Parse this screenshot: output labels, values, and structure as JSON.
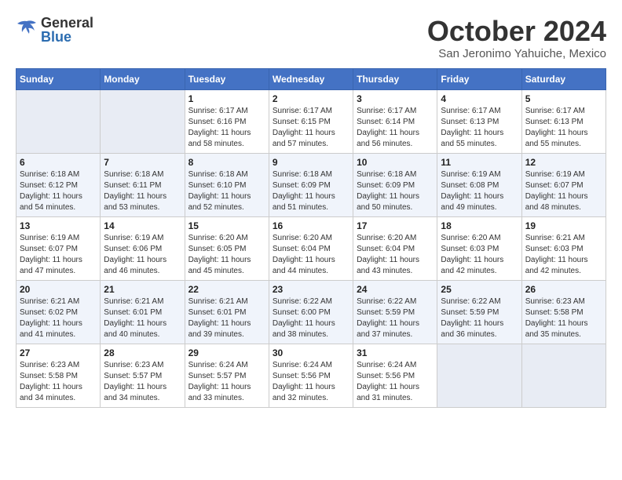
{
  "header": {
    "logo_general": "General",
    "logo_blue": "Blue",
    "month_title": "October 2024",
    "location": "San Jeronimo Yahuiche, Mexico"
  },
  "weekdays": [
    "Sunday",
    "Monday",
    "Tuesday",
    "Wednesday",
    "Thursday",
    "Friday",
    "Saturday"
  ],
  "weeks": [
    [
      {
        "day": "",
        "info": ""
      },
      {
        "day": "",
        "info": ""
      },
      {
        "day": "1",
        "info": "Sunrise: 6:17 AM\nSunset: 6:16 PM\nDaylight: 11 hours and 58 minutes."
      },
      {
        "day": "2",
        "info": "Sunrise: 6:17 AM\nSunset: 6:15 PM\nDaylight: 11 hours and 57 minutes."
      },
      {
        "day": "3",
        "info": "Sunrise: 6:17 AM\nSunset: 6:14 PM\nDaylight: 11 hours and 56 minutes."
      },
      {
        "day": "4",
        "info": "Sunrise: 6:17 AM\nSunset: 6:13 PM\nDaylight: 11 hours and 55 minutes."
      },
      {
        "day": "5",
        "info": "Sunrise: 6:17 AM\nSunset: 6:13 PM\nDaylight: 11 hours and 55 minutes."
      }
    ],
    [
      {
        "day": "6",
        "info": "Sunrise: 6:18 AM\nSunset: 6:12 PM\nDaylight: 11 hours and 54 minutes."
      },
      {
        "day": "7",
        "info": "Sunrise: 6:18 AM\nSunset: 6:11 PM\nDaylight: 11 hours and 53 minutes."
      },
      {
        "day": "8",
        "info": "Sunrise: 6:18 AM\nSunset: 6:10 PM\nDaylight: 11 hours and 52 minutes."
      },
      {
        "day": "9",
        "info": "Sunrise: 6:18 AM\nSunset: 6:09 PM\nDaylight: 11 hours and 51 minutes."
      },
      {
        "day": "10",
        "info": "Sunrise: 6:18 AM\nSunset: 6:09 PM\nDaylight: 11 hours and 50 minutes."
      },
      {
        "day": "11",
        "info": "Sunrise: 6:19 AM\nSunset: 6:08 PM\nDaylight: 11 hours and 49 minutes."
      },
      {
        "day": "12",
        "info": "Sunrise: 6:19 AM\nSunset: 6:07 PM\nDaylight: 11 hours and 48 minutes."
      }
    ],
    [
      {
        "day": "13",
        "info": "Sunrise: 6:19 AM\nSunset: 6:07 PM\nDaylight: 11 hours and 47 minutes."
      },
      {
        "day": "14",
        "info": "Sunrise: 6:19 AM\nSunset: 6:06 PM\nDaylight: 11 hours and 46 minutes."
      },
      {
        "day": "15",
        "info": "Sunrise: 6:20 AM\nSunset: 6:05 PM\nDaylight: 11 hours and 45 minutes."
      },
      {
        "day": "16",
        "info": "Sunrise: 6:20 AM\nSunset: 6:04 PM\nDaylight: 11 hours and 44 minutes."
      },
      {
        "day": "17",
        "info": "Sunrise: 6:20 AM\nSunset: 6:04 PM\nDaylight: 11 hours and 43 minutes."
      },
      {
        "day": "18",
        "info": "Sunrise: 6:20 AM\nSunset: 6:03 PM\nDaylight: 11 hours and 42 minutes."
      },
      {
        "day": "19",
        "info": "Sunrise: 6:21 AM\nSunset: 6:03 PM\nDaylight: 11 hours and 42 minutes."
      }
    ],
    [
      {
        "day": "20",
        "info": "Sunrise: 6:21 AM\nSunset: 6:02 PM\nDaylight: 11 hours and 41 minutes."
      },
      {
        "day": "21",
        "info": "Sunrise: 6:21 AM\nSunset: 6:01 PM\nDaylight: 11 hours and 40 minutes."
      },
      {
        "day": "22",
        "info": "Sunrise: 6:21 AM\nSunset: 6:01 PM\nDaylight: 11 hours and 39 minutes."
      },
      {
        "day": "23",
        "info": "Sunrise: 6:22 AM\nSunset: 6:00 PM\nDaylight: 11 hours and 38 minutes."
      },
      {
        "day": "24",
        "info": "Sunrise: 6:22 AM\nSunset: 5:59 PM\nDaylight: 11 hours and 37 minutes."
      },
      {
        "day": "25",
        "info": "Sunrise: 6:22 AM\nSunset: 5:59 PM\nDaylight: 11 hours and 36 minutes."
      },
      {
        "day": "26",
        "info": "Sunrise: 6:23 AM\nSunset: 5:58 PM\nDaylight: 11 hours and 35 minutes."
      }
    ],
    [
      {
        "day": "27",
        "info": "Sunrise: 6:23 AM\nSunset: 5:58 PM\nDaylight: 11 hours and 34 minutes."
      },
      {
        "day": "28",
        "info": "Sunrise: 6:23 AM\nSunset: 5:57 PM\nDaylight: 11 hours and 34 minutes."
      },
      {
        "day": "29",
        "info": "Sunrise: 6:24 AM\nSunset: 5:57 PM\nDaylight: 11 hours and 33 minutes."
      },
      {
        "day": "30",
        "info": "Sunrise: 6:24 AM\nSunset: 5:56 PM\nDaylight: 11 hours and 32 minutes."
      },
      {
        "day": "31",
        "info": "Sunrise: 6:24 AM\nSunset: 5:56 PM\nDaylight: 11 hours and 31 minutes."
      },
      {
        "day": "",
        "info": ""
      },
      {
        "day": "",
        "info": ""
      }
    ]
  ]
}
